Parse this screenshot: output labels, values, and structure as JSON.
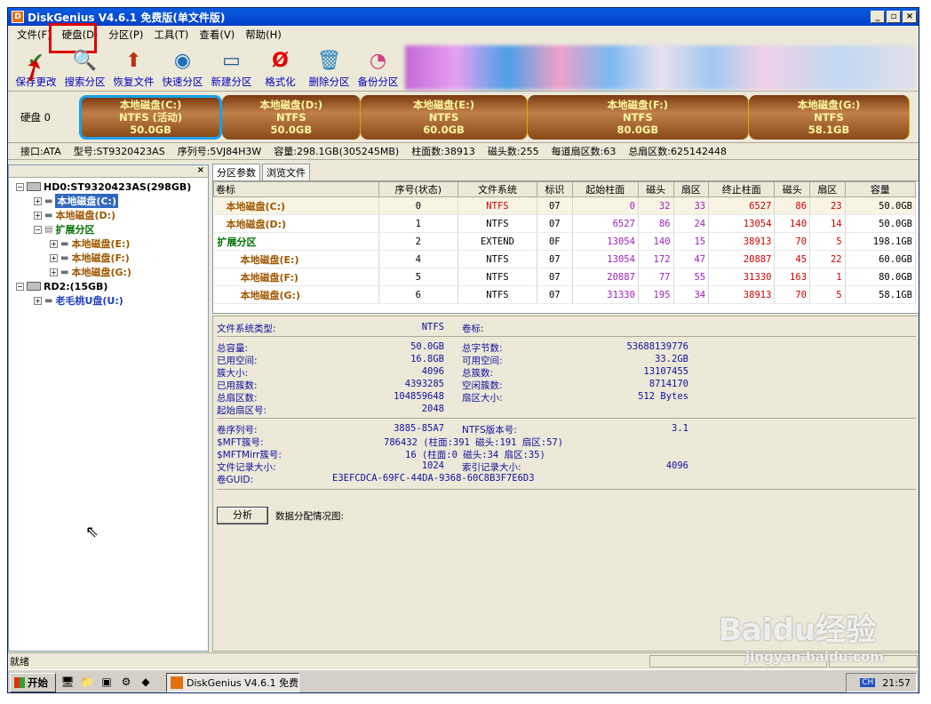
{
  "window": {
    "title": "DiskGenius V4.6.1 免费版(单文件版)"
  },
  "menu": [
    "文件(F)",
    "硬盘(D)",
    "分区(P)",
    "工具(T)",
    "查看(V)",
    "帮助(H)"
  ],
  "toolbar": [
    {
      "label": "保存更改",
      "icon": "save-icon",
      "glyph": "✔"
    },
    {
      "label": "搜索分区",
      "icon": "search-icon",
      "glyph": "🔍"
    },
    {
      "label": "恢复文件",
      "icon": "restore-icon",
      "glyph": "⬆"
    },
    {
      "label": "快速分区",
      "icon": "quick-partition-icon",
      "glyph": "◉"
    },
    {
      "label": "新建分区",
      "icon": "new-partition-icon",
      "glyph": "▭"
    },
    {
      "label": "格式化",
      "icon": "format-icon",
      "glyph": "Ø"
    },
    {
      "label": "删除分区",
      "icon": "delete-icon",
      "glyph": "🗑"
    },
    {
      "label": "备份分区",
      "icon": "backup-icon",
      "glyph": "◔"
    }
  ],
  "disk_label": "硬盘 0",
  "partitions_bar": [
    {
      "name": "本地磁盘(C:)",
      "fs": "NTFS (活动)",
      "size": "50.0GB",
      "flex": 50,
      "active": true
    },
    {
      "name": "本地磁盘(D:)",
      "fs": "NTFS",
      "size": "50.0GB",
      "flex": 50,
      "active": false
    },
    {
      "name": "本地磁盘(E:)",
      "fs": "NTFS",
      "size": "60.0GB",
      "flex": 60,
      "active": false
    },
    {
      "name": "本地磁盘(F:)",
      "fs": "NTFS",
      "size": "80.0GB",
      "flex": 80,
      "active": false
    },
    {
      "name": "本地磁盘(G:)",
      "fs": "NTFS",
      "size": "58.1GB",
      "flex": 58,
      "active": false
    }
  ],
  "disk_info": [
    "接口:ATA",
    "型号:ST9320423AS",
    "序列号:5VJ84H3W",
    "容量:298.1GB(305245MB)",
    "柱面数:38913",
    "磁头数:255",
    "每道扇区数:63",
    "总扇区数:625142448"
  ],
  "tree": {
    "close": "×",
    "hd0": "HD0:ST9320423AS(298GB)",
    "c": "本地磁盘(C:)",
    "d": "本地磁盘(D:)",
    "ext": "扩展分区",
    "e": "本地磁盘(E:)",
    "f": "本地磁盘(F:)",
    "g": "本地磁盘(G:)",
    "rd2": "RD2:(15GB)",
    "u": "老毛桃U盘(U:)"
  },
  "tabs": [
    "分区参数",
    "浏览文件"
  ],
  "table": {
    "headers": [
      "卷标",
      "序号(状态)",
      "文件系统",
      "标识",
      "起始柱面",
      "磁头",
      "扇区",
      "终止柱面",
      "磁头",
      "扇区",
      "容量"
    ],
    "rows": [
      {
        "label": "本地磁盘(C:)",
        "idx": "0",
        "fs": "NTFS",
        "id": "07",
        "sc": "0",
        "sh": "32",
        "ss": "33",
        "ec": "6527",
        "eh": "86",
        "es": "23",
        "cap": "50.0GB"
      },
      {
        "label": "本地磁盘(D:)",
        "idx": "1",
        "fs": "NTFS",
        "id": "07",
        "sc": "6527",
        "sh": "86",
        "ss": "24",
        "ec": "13054",
        "eh": "140",
        "es": "14",
        "cap": "50.0GB"
      },
      {
        "label": "扩展分区",
        "idx": "2",
        "fs": "EXTEND",
        "id": "0F",
        "sc": "13054",
        "sh": "140",
        "ss": "15",
        "ec": "38913",
        "eh": "70",
        "es": "5",
        "cap": "198.1GB"
      },
      {
        "label": "本地磁盘(E:)",
        "idx": "4",
        "fs": "NTFS",
        "id": "07",
        "sc": "13054",
        "sh": "172",
        "ss": "47",
        "ec": "20887",
        "eh": "45",
        "es": "22",
        "cap": "60.0GB"
      },
      {
        "label": "本地磁盘(F:)",
        "idx": "5",
        "fs": "NTFS",
        "id": "07",
        "sc": "20887",
        "sh": "77",
        "ss": "55",
        "ec": "31330",
        "eh": "163",
        "es": "1",
        "cap": "80.0GB"
      },
      {
        "label": "本地磁盘(G:)",
        "idx": "6",
        "fs": "NTFS",
        "id": "07",
        "sc": "31330",
        "sh": "195",
        "ss": "34",
        "ec": "38913",
        "eh": "70",
        "es": "5",
        "cap": "58.1GB"
      }
    ]
  },
  "details": {
    "fs_type_label": "文件系统类型:",
    "fs_type": "NTFS",
    "vol_label": "卷标:",
    "total_cap_label": "总容量:",
    "total_cap": "50.0GB",
    "total_bytes_label": "总字节数:",
    "total_bytes": "53688139776",
    "used_label": "已用空间:",
    "used": "16.8GB",
    "free_label": "可用空间:",
    "free": "33.2GB",
    "cluster_label": "簇大小:",
    "cluster": "4096",
    "total_clusters_label": "总簇数:",
    "total_clusters": "13107455",
    "used_clusters_label": "已用簇数:",
    "used_clusters": "4393285",
    "free_clusters_label": "空闲簇数:",
    "free_clusters": "8714170",
    "total_sectors_label": "总扇区数:",
    "total_sectors": "104859648",
    "sector_size_label": "扇区大小:",
    "sector_size": "512 Bytes",
    "start_sector_label": "起始扇区号:",
    "start_sector": "2048",
    "serial_label": "卷序列号:",
    "serial": "3885-85A7",
    "ntfs_ver_label": "NTFS版本号:",
    "ntfs_ver": "3.1",
    "mft_label": "$MFT簇号:",
    "mft": "786432 (柱面:391 磁头:191 扇区:57)",
    "mftmirr_label": "$MFTMirr簇号:",
    "mftmirr": "16 (柱面:0 磁头:34 扇区:35)",
    "record_label": "文件记录大小:",
    "record": "1024",
    "index_label": "索引记录大小:",
    "index": "4096",
    "guid_label": "卷GUID:",
    "guid": "E3EFCDCA-69FC-44DA-9368-60C8B3F7E6D3",
    "analyze": "分析",
    "alloc_label": "数据分配情况图:"
  },
  "status": "就绪",
  "taskbar": {
    "start": "开始",
    "item": "DiskGenius V4.6.1 免费...",
    "time": "21:57",
    "ime": "CH"
  },
  "watermark": {
    "line1": "Baidu经验",
    "line2": "jingyan.baidu.com"
  }
}
